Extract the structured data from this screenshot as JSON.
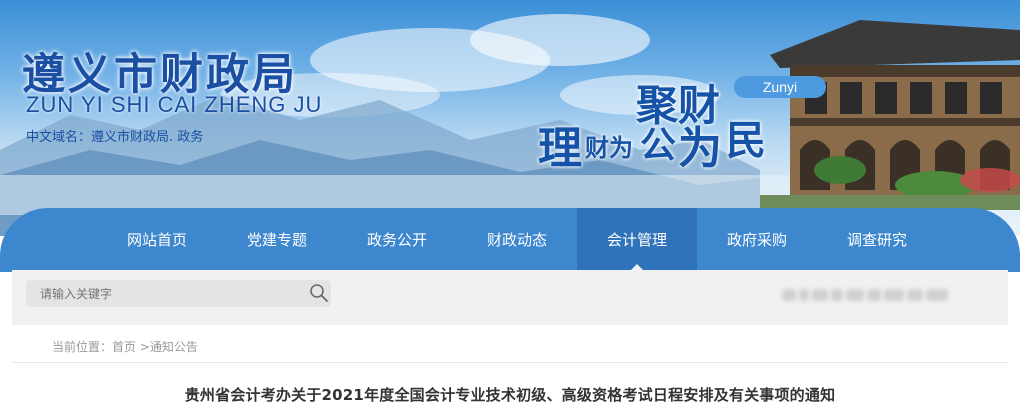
{
  "header": {
    "title": "遵义市财政局",
    "pinyin": "ZUN YI SHI CAI ZHENG JU",
    "domain": "中文域名：遵义市财政局. 政务",
    "slogan": {
      "ju_cai": "聚财",
      "li": "理",
      "cai_wei": "财为",
      "gong": "公",
      "wei": "为",
      "min": "民",
      "badge": "Zunyi"
    }
  },
  "nav": {
    "items": [
      {
        "label": "网站首页"
      },
      {
        "label": "党建专题"
      },
      {
        "label": "政务公开"
      },
      {
        "label": "财政动态"
      },
      {
        "label": "会计管理"
      },
      {
        "label": "政府采购"
      },
      {
        "label": "调查研究"
      }
    ],
    "active": "会计管理"
  },
  "search": {
    "placeholder": "请输入关键字"
  },
  "breadcrumb": {
    "prefix": "当前位置：",
    "home": "首页",
    "separator": " >",
    "current": "通知公告"
  },
  "article": {
    "title": "贵州省会计考办关于2021年度全国会计专业技术初级、高级资格考试日程安排及有关事项的通知"
  },
  "colors": {
    "brand_blue": "#1a4fa3",
    "nav_blue": "#3d87cf",
    "nav_active": "#2f74bb"
  },
  "icons": {
    "search": "search-icon"
  }
}
